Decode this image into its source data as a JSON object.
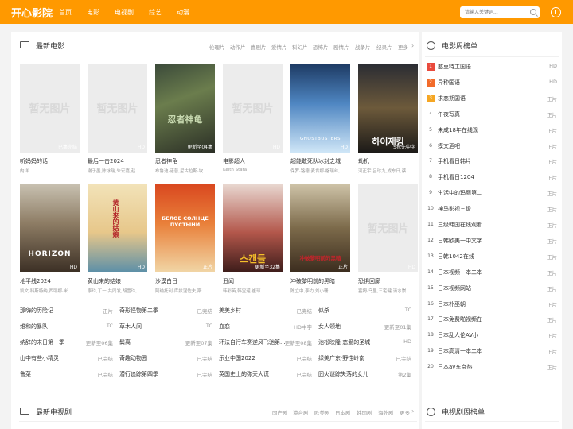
{
  "header": {
    "logo": "开心影院",
    "nav": [
      "首页",
      "电影",
      "电视剧",
      "综艺",
      "动漫"
    ],
    "search_placeholder": "请输入关键词..."
  },
  "movies_section": {
    "title": "最新电影",
    "categories": [
      "伦理片",
      "动作片",
      "喜剧片",
      "爱情片",
      "科幻片",
      "恐怖片",
      "剧情片",
      "战争片",
      "纪录片",
      "更多"
    ],
    "no_image_text": "暂无图片",
    "cards": [
      {
        "title": "听妈妈的话",
        "cast": "内详",
        "badge": "已集完结",
        "poster": "none"
      },
      {
        "title": "最后一击2024",
        "cast": "谢子墨,陈冰瑞,朱宏嘉,赵...",
        "badge": "HD",
        "poster": "none"
      },
      {
        "title": "忍者神龟",
        "cast": "布鲁迪·诺普,尼古拉斯·坎...",
        "badge": "更新至04集",
        "poster": "turtles",
        "poster_text": "忍者神龟"
      },
      {
        "title": "电影超人",
        "cast": "Keith Stata",
        "badge": "HD",
        "poster": "none"
      },
      {
        "title": "超能敢死队冰封之城",
        "cast": "保罗·路德,麦肯娜·格瑞丝,...",
        "badge": "HD",
        "poster": "ice",
        "poster_text": "GHOSTBUSTERS"
      },
      {
        "title": "劫机",
        "cast": "河正宇,吕珍九,成东日,蔡...",
        "badge": "TS抢先中字",
        "poster": "hijack",
        "poster_text": "하이재킹"
      },
      {
        "title": "地平线2024",
        "cast": "凯文·科斯特纳,西耶娜·米...",
        "badge": "HD",
        "poster": "horizon",
        "poster_text": "HORIZON"
      },
      {
        "title": "黄山来的姑娘",
        "cast": "李玲,丁一,共同发,胡雪玲,...",
        "badge": "HD",
        "poster": "huangshan",
        "poster_text": "黄山来的姑娘"
      },
      {
        "title": "沙漠白日",
        "cast": "阿纳托利·库兹涅佐夫,斯...",
        "badge": "正片",
        "poster": "desert",
        "poster_text": "БЕЛОЕ СОЛНЦЕ ПУСТЫНИ"
      },
      {
        "title": "丑闻",
        "cast": "韩彩英,韩宝暹,崔琼",
        "badge": "更新至32集",
        "poster": "scandal",
        "poster_text": "스캔들"
      },
      {
        "title": "冲破黎明前的黑暗",
        "cast": "陈立中,李力,刘小珊",
        "badge": "正片",
        "poster": "dawn",
        "poster_text": "冲破黎明前的黑暗"
      },
      {
        "title": "恐惧回廊",
        "cast": "塞姆·乌里,三宅健,清水崇",
        "badge": "HD",
        "poster": "none"
      }
    ]
  },
  "text_list": [
    [
      {
        "t": "那嗨的历险记",
        "s": "正片"
      },
      {
        "t": "奇形怪物第二季",
        "s": "已完结"
      },
      {
        "t": "美美乡村",
        "s": "已完结"
      },
      {
        "t": "似杀",
        "s": "TC"
      }
    ],
    [
      {
        "t": "维和的暴队",
        "s": "TC"
      },
      {
        "t": "草木人间",
        "s": "TC"
      },
      {
        "t": "血恋",
        "s": "HD中字"
      },
      {
        "t": "女人领地",
        "s": "更新至01集"
      }
    ],
    [
      {
        "t": "纳辞的末日第一季",
        "s": "更新至06集"
      },
      {
        "t": "鬓离",
        "s": "更新至07集"
      },
      {
        "t": "环法自行车赛逆风飞驰第...",
        "s": "更新至08集"
      },
      {
        "t": "池松映隆·恋爱的圣城",
        "s": "HD"
      }
    ],
    [
      {
        "t": "山中有些小精灵",
        "s": "已完结"
      },
      {
        "t": "奇趣动物园",
        "s": "已完结"
      },
      {
        "t": "乐业中国2022",
        "s": "已完结"
      },
      {
        "t": "绿美广东·野性岭南",
        "s": "已完结"
      }
    ],
    [
      {
        "t": "鲁菜",
        "s": "已完结"
      },
      {
        "t": "潜行追踪第四季",
        "s": "已完结"
      },
      {
        "t": "英国史上的弥天大谎",
        "s": "已完结"
      },
      {
        "t": "囧火谜踪失落的女儿",
        "s": "第2集"
      }
    ]
  ],
  "ranking": {
    "title": "电影周榜单",
    "items": [
      {
        "n": "1",
        "t": "憨豆特工国语",
        "s": "HD"
      },
      {
        "n": "2",
        "t": "异种国语",
        "s": "HD"
      },
      {
        "n": "3",
        "t": "求恋期国语",
        "s": "正片"
      },
      {
        "n": "4",
        "t": "午夜写真",
        "s": "正片"
      },
      {
        "n": "5",
        "t": "未成18年在线观",
        "s": "正片"
      },
      {
        "n": "6",
        "t": "摸文酒吧",
        "s": "正片"
      },
      {
        "n": "7",
        "t": "手机看日韩片",
        "s": "正片"
      },
      {
        "n": "8",
        "t": "手机看日1204",
        "s": "正片"
      },
      {
        "n": "9",
        "t": "生活中的玛丽第二",
        "s": "正片"
      },
      {
        "n": "10",
        "t": "神马影视三级",
        "s": "正片"
      },
      {
        "n": "11",
        "t": "三级韩国在线观看",
        "s": "正片"
      },
      {
        "n": "12",
        "t": "日韩欧美一中文字",
        "s": "正片"
      },
      {
        "n": "13",
        "t": "日韩1042在线",
        "s": "正片"
      },
      {
        "n": "14",
        "t": "日本视频一本二本",
        "s": "正片"
      },
      {
        "n": "15",
        "t": "日本视频网站",
        "s": "正片"
      },
      {
        "n": "16",
        "t": "日本朴巫朝",
        "s": "正片"
      },
      {
        "n": "17",
        "t": "日本免费啪视频在",
        "s": "正片"
      },
      {
        "n": "18",
        "t": "日本乱人伦AV小",
        "s": "正片"
      },
      {
        "n": "19",
        "t": "日本高清一本二本",
        "s": "正片"
      },
      {
        "n": "20",
        "t": "日本av东京热",
        "s": "正片"
      }
    ]
  },
  "tv_section": {
    "title": "最新电视剧",
    "categories": [
      "国产剧",
      "港台剧",
      "欧美剧",
      "日本剧",
      "韩国剧",
      "海外剧",
      "更多"
    ]
  },
  "tv_ranking": {
    "title": "电视剧周榜单"
  },
  "colors": {
    "accent": "#ff9900",
    "rank1": "#e94a3d",
    "rank2": "#f26b2a",
    "rank3": "#f5a623"
  }
}
